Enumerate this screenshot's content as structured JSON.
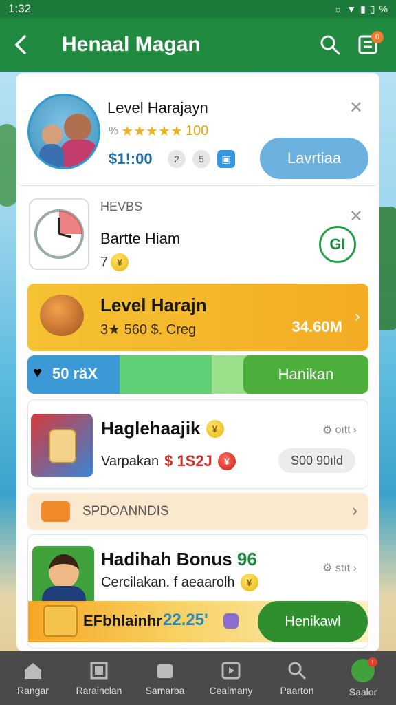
{
  "status_bar": {
    "time": "1:32",
    "battery": "%"
  },
  "app_bar": {
    "title": "Henaal Magan",
    "back_icon": "back-arrow-icon",
    "search_icon": "search-icon",
    "menu_icon": "list-icon",
    "menu_badge": "0"
  },
  "card1": {
    "title": "Level Harajayn",
    "rating_value": "100",
    "price": "$1!:00",
    "chip1": "2",
    "chip2": "5",
    "button": "Lavrtiaa"
  },
  "card2": {
    "label": "HEVBS",
    "title": "Bartte Hiam",
    "count": "7",
    "action": "GI"
  },
  "card3": {
    "title": "Level Harajn",
    "sub": "3★ 560 $. Creg",
    "value": "34.60M"
  },
  "progress": {
    "label": "50 räX",
    "button": "Hanikan",
    "fill_blue_pct": 27,
    "fill_green_pct": 27
  },
  "card5": {
    "title": "Haglehaajik",
    "sub_text": "Varpakan",
    "price": "$ 1S2J",
    "option": "oıtt",
    "pill": "S00 90ıld"
  },
  "card6": {
    "label": "SPDOANNDIS"
  },
  "card7": {
    "title": "Hadihah Bonus",
    "title_num": "96",
    "sub": "Cercilakan. f aeaarolh",
    "option": "stıt",
    "banner_text": "EFbhlainhr",
    "banner_value": "22.25'",
    "button": "Henikawl"
  },
  "bottom_nav": [
    {
      "label": "Rangar",
      "icon": "home-icon"
    },
    {
      "label": "Rarainclan",
      "icon": "grid-icon"
    },
    {
      "label": "Samarba",
      "icon": "box-icon"
    },
    {
      "label": "Cealmany",
      "icon": "play-icon"
    },
    {
      "label": "Paarton",
      "icon": "search-icon"
    },
    {
      "label": "Saalor",
      "icon": "avatar-icon"
    }
  ]
}
